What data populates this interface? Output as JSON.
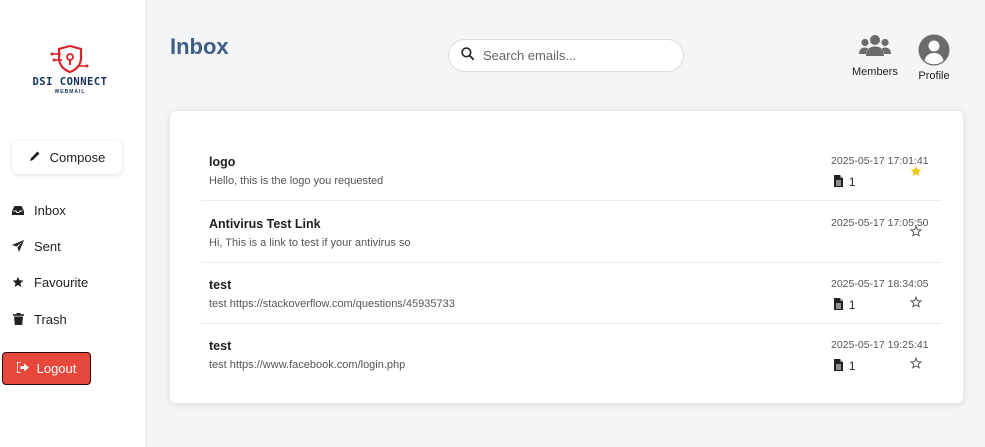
{
  "app": {
    "logo_title": "DSI CONNECT",
    "logo_subtitle": "WEBMAIL",
    "brand_color": "#d9252a",
    "brand_navy": "#14325a"
  },
  "sidebar": {
    "compose_label": "Compose",
    "items": [
      {
        "label": "Inbox",
        "icon": "inbox-icon"
      },
      {
        "label": "Sent",
        "icon": "paper-plane-icon"
      },
      {
        "label": "Favourite",
        "icon": "star-icon"
      },
      {
        "label": "Trash",
        "icon": "trash-icon"
      }
    ],
    "logout_label": "Logout",
    "logout_color": "#e8473c"
  },
  "header": {
    "title": "Inbox",
    "title_color": "#3d5f86",
    "search_placeholder": "Search emails...",
    "members_label": "Members",
    "profile_label": "Profile"
  },
  "emails": [
    {
      "subject": "logo",
      "preview": "Hello, this is the logo you requested",
      "date": "2025-05-17 17:01:41",
      "attachments": "1",
      "favourite": true
    },
    {
      "subject": "Antivirus Test Link",
      "preview": "Hi, This is a link to test if your antivirus so",
      "date": "2025-05-17 17:05:50",
      "attachments": null,
      "favourite": false
    },
    {
      "subject": "test",
      "preview": "test https://stackoverflow.com/questions/45935733",
      "date": "2025-05-17 18:34:05",
      "attachments": "1",
      "favourite": false
    },
    {
      "subject": "test",
      "preview": "test https://www.facebook.com/login.php",
      "date": "2025-05-17 19:25:41",
      "attachments": "1",
      "favourite": false
    }
  ],
  "colors": {
    "star_active": "#f5c518",
    "star_inactive": "#555555"
  }
}
